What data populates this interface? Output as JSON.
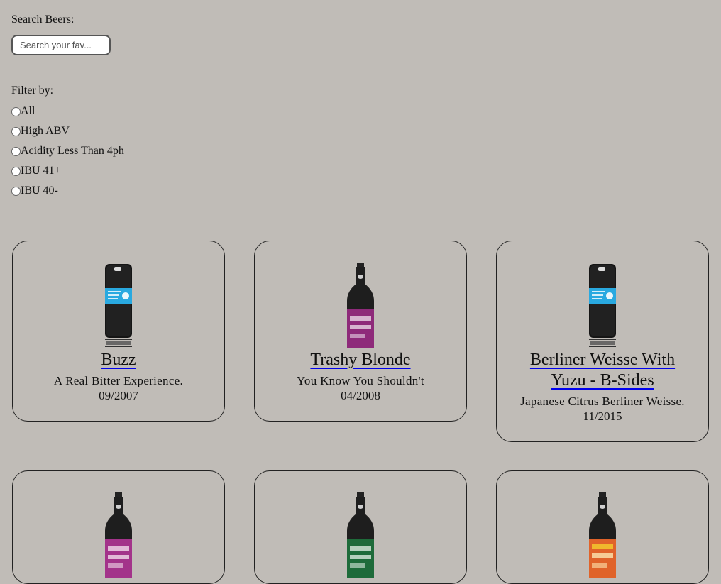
{
  "search": {
    "label": "Search Beers:",
    "placeholder": "Search your fav...",
    "value": ""
  },
  "filter": {
    "label": "Filter by:",
    "options": [
      "All",
      "High ABV",
      "Acidity Less Than 4ph",
      "IBU 41+",
      "IBU 40-"
    ]
  },
  "beers": [
    {
      "name": "Buzz",
      "tagline": "A Real Bitter Experience.",
      "first_brewed": "09/2007",
      "image": "keg-icon",
      "label_color": "#29a9e0"
    },
    {
      "name": "Trashy Blonde",
      "tagline": "You Know You Shouldn't",
      "first_brewed": "04/2008",
      "image": "bottle-icon",
      "label_color": "#8e2a7a"
    },
    {
      "name": "Berliner Weisse With Yuzu - B-Sides",
      "tagline": "Japanese Citrus Berliner Weisse.",
      "first_brewed": "11/2015",
      "image": "keg-icon",
      "label_color": "#29a9e0"
    },
    {
      "image": "bottle-icon",
      "label_color": "#a3338a"
    },
    {
      "image": "bottle-icon",
      "label_color": "#1e6b3a"
    },
    {
      "image": "bottle-icon",
      "label_color": "#e0632a"
    }
  ]
}
